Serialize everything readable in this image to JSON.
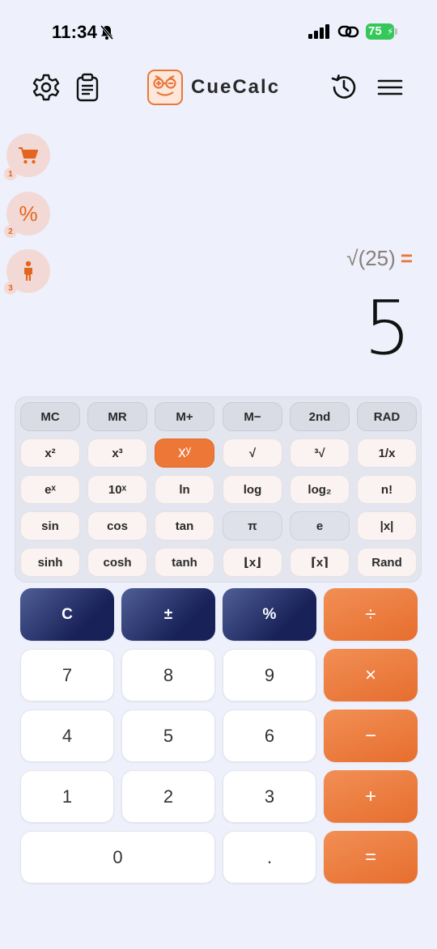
{
  "status_bar": {
    "time": "11:34",
    "battery": "75",
    "battery_color": "#34c759"
  },
  "header": {
    "settings_icon": "gear-icon",
    "clipboard_icon": "clipboard-icon",
    "app_title": "CueCalc",
    "history_icon": "history-icon",
    "menu_icon": "hamburger-menu-icon"
  },
  "side_shortcuts": [
    {
      "icon": "cart-icon",
      "glyph": "",
      "number": "1"
    },
    {
      "icon": "percent-icon",
      "glyph": "%",
      "number": "2"
    },
    {
      "icon": "person-icon",
      "glyph": "",
      "number": "3"
    }
  ],
  "display": {
    "expression": "√(25)",
    "equals": "=",
    "result": "5"
  },
  "scientific_keys": {
    "row1": [
      "MC",
      "MR",
      "M+",
      "M−",
      "2nd",
      "RAD"
    ],
    "row2": [
      "x²",
      "x³",
      "xʸ",
      "√",
      "³√",
      "1/x"
    ],
    "row3": [
      "eˣ",
      "10ˣ",
      "ln",
      "log",
      "log₂",
      "n!"
    ],
    "row4": [
      "sin",
      "cos",
      "tan",
      "π",
      "e",
      "|x|"
    ],
    "row5": [
      "sinh",
      "cosh",
      "tanh",
      "⌊x⌋",
      "⌈x⌉",
      "Rand"
    ]
  },
  "keypad": {
    "clear": "C",
    "negate": "±",
    "percent": "%",
    "divide": "÷",
    "multiply": "×",
    "subtract": "−",
    "add": "+",
    "equals": "=",
    "digits": [
      "7",
      "8",
      "9",
      "4",
      "5",
      "6",
      "1",
      "2",
      "3",
      "0",
      "."
    ]
  },
  "colors": {
    "accent": "#e8773b",
    "dark_key": "#182158",
    "background": "#eef0fb"
  }
}
